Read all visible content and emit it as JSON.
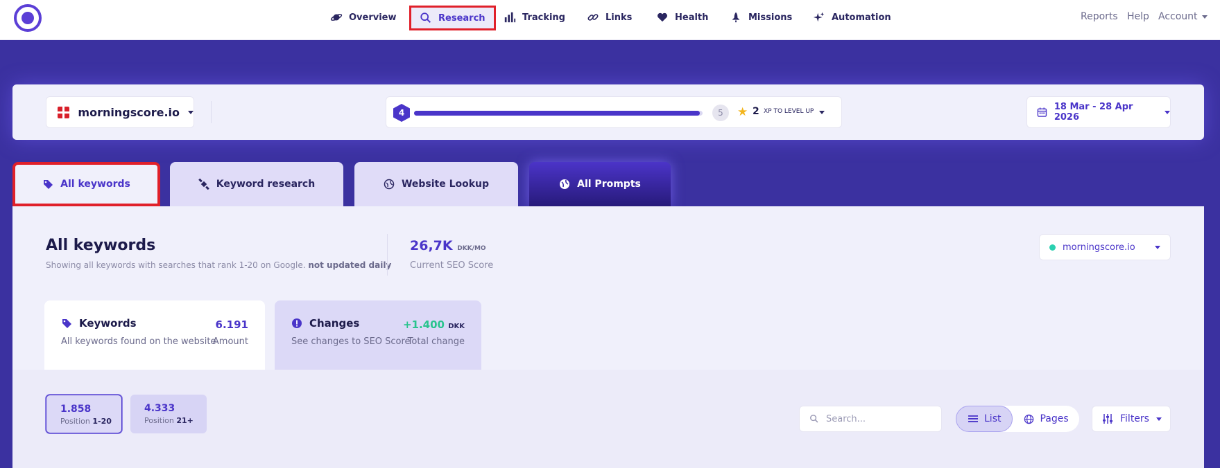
{
  "nav": {
    "items": [
      {
        "label": "Overview",
        "icon": "planet-icon"
      },
      {
        "label": "Research",
        "icon": "search-icon"
      },
      {
        "label": "Tracking",
        "icon": "bar-chart-icon"
      },
      {
        "label": "Links",
        "icon": "link-icon"
      },
      {
        "label": "Health",
        "icon": "heart-icon"
      },
      {
        "label": "Missions",
        "icon": "rocket-icon"
      },
      {
        "label": "Automation",
        "icon": "sparkle-icon"
      }
    ],
    "right": {
      "reports": "Reports",
      "help": "Help",
      "account": "Account"
    }
  },
  "selector": {
    "domain": "morningscore.io",
    "level": "4",
    "next_level": "5",
    "xp_progress": 0.99,
    "xp_needed": "2",
    "xp_label": "XP TO LEVEL UP",
    "date_range": "18 Mar - 28 Apr 2026"
  },
  "tabs": [
    {
      "label": "All keywords",
      "icon": "tag-icon"
    },
    {
      "label": "Keyword research",
      "icon": "satellite-icon"
    },
    {
      "label": "Website Lookup",
      "icon": "globe-icon"
    },
    {
      "label": "All Prompts",
      "icon": "globe-icon"
    }
  ],
  "header": {
    "title": "All keywords",
    "subtitle": "Showing all keywords with searches that rank 1-20 on Google.",
    "subtitle_bold": "not updated daily",
    "score_value": "26,7K",
    "score_unit": "DKK/MO",
    "score_label": "Current SEO Score",
    "domain_select": "morningscore.io"
  },
  "cards": [
    {
      "title": "Keywords",
      "desc": "All keywords found on the website",
      "value": "6.191",
      "value_label": "Amount"
    },
    {
      "title": "Changes",
      "desc": "See changes to SEO Score",
      "value": "+1.400",
      "unit": "DKK",
      "value_label": "Total change"
    }
  ],
  "positions": [
    {
      "value": "1.858",
      "label": "Position",
      "range": "1-20"
    },
    {
      "value": "4.333",
      "label": "Position",
      "range": "21+"
    }
  ],
  "toolbar": {
    "search_placeholder": "Search...",
    "list_label": "List",
    "pages_label": "Pages",
    "filters_label": "Filters"
  },
  "colors": {
    "accent": "#4a35c9",
    "background": "#3b31a0",
    "highlight": "#e0202a",
    "positive": "#2ac48e"
  }
}
